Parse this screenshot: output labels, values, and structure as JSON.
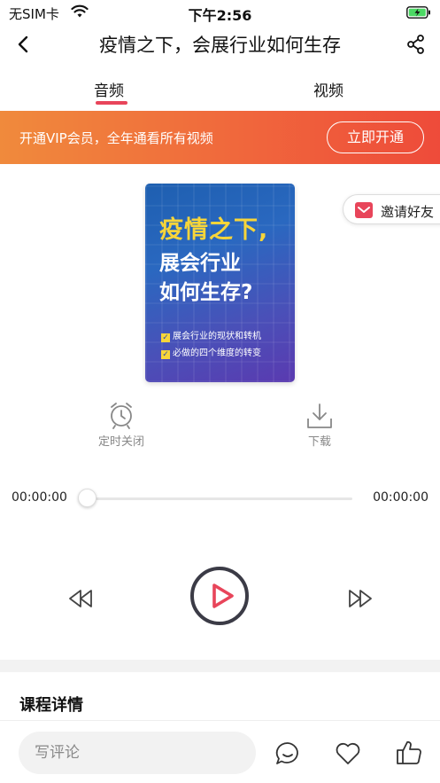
{
  "status": {
    "carrier": "无SIM卡",
    "time": "下午2:56",
    "icons": [
      "wifi-icon",
      "battery-charging-icon"
    ]
  },
  "nav": {
    "title": "疫情之下，会展行业如何生存",
    "back_icon": "chevron-left-icon",
    "share_icon": "share-icon"
  },
  "tabs": {
    "items": [
      {
        "label": "音频",
        "active": true
      },
      {
        "label": "视频",
        "active": false
      }
    ],
    "accent_color": "#e8455a"
  },
  "vip_banner": {
    "text": "开通VIP会员，全年通看所有视频",
    "button_label": "立即开通"
  },
  "cover": {
    "line1": "疫情之下,",
    "line2": "展会行业",
    "line3": "如何生存?",
    "bullets": [
      "展会行业的现状和转机",
      "必做的四个维度的转变"
    ]
  },
  "invite": {
    "label": "邀请好友",
    "icon": "gift-envelope-icon"
  },
  "actions": {
    "timer_label": "定时关闭",
    "download_label": "下载"
  },
  "player": {
    "current_time": "00:00:00",
    "total_time": "00:00:00",
    "progress": 0
  },
  "details": {
    "heading": "课程详情"
  },
  "bottom_bar": {
    "comment_placeholder": "写评论",
    "icons": [
      "comment-icon",
      "heart-icon",
      "thumbs-up-icon"
    ]
  }
}
